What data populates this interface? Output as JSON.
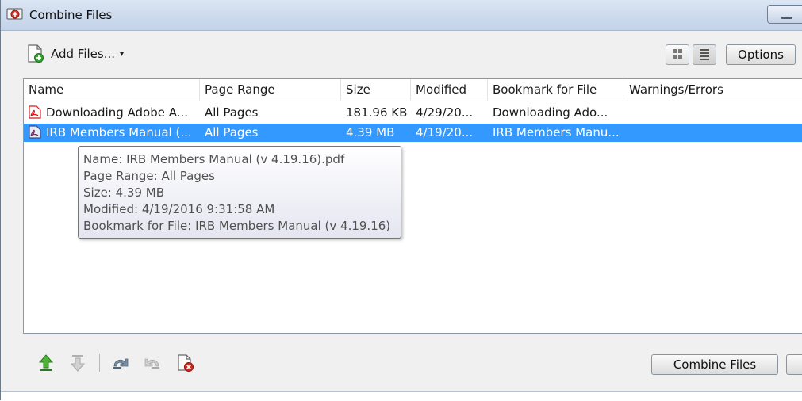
{
  "window": {
    "title": "Combine Files"
  },
  "toolbar": {
    "add_files_label": "Add Files...",
    "add_files_arrow": "▾",
    "options_label": "Options"
  },
  "columns": [
    "Name",
    "Page Range",
    "Size",
    "Modified",
    "Bookmark for File",
    "Warnings/Errors"
  ],
  "files": [
    {
      "name": "Downloading Adobe A...",
      "page_range": "All Pages",
      "size": "181.96 KB",
      "modified": "4/29/20...",
      "bookmark": "Downloading Ado...",
      "warnings": "",
      "selected": false,
      "icon": "pdf-icon"
    },
    {
      "name": "IRB Members Manual (...",
      "page_range": "All Pages",
      "size": "4.39 MB",
      "modified": "4/19/20...",
      "bookmark": "IRB Members Manu...",
      "warnings": "",
      "selected": true,
      "icon": "pdf-portfolio-icon"
    }
  ],
  "tooltip": {
    "name": "Name: IRB Members Manual (v 4.19.16).pdf",
    "page_range": "Page Range: All Pages",
    "size": "Size: 4.39 MB",
    "modified": "Modified: 4/19/2016 9:31:58 AM",
    "bookmark": "Bookmark for File: IRB Members Manual (v 4.19.16)"
  },
  "footer": {
    "combine_label": "Combine Files"
  },
  "icons": [
    "combine-files-app-icon",
    "add-file-icon",
    "thumbnail-view-icon",
    "list-view-icon",
    "move-up-icon",
    "move-down-icon",
    "undo-icon",
    "redo-icon",
    "remove-file-icon"
  ],
  "colors": {
    "selection": "#3399ff",
    "move_up": "#3a9a2a",
    "remove": "#d9261c"
  }
}
